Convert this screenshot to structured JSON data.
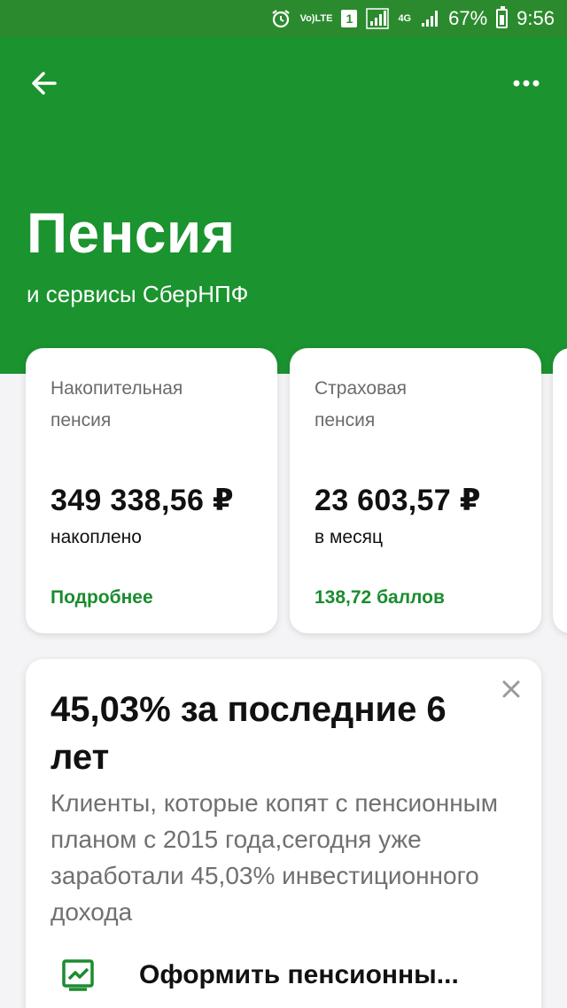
{
  "status_bar": {
    "volte_top": "Vo)",
    "volte_bottom": "LTE",
    "sim_slot": "1",
    "network": "4G",
    "battery": "67%",
    "time": "9:56"
  },
  "header": {
    "title": "Пенсия",
    "subtitle": "и сервисы СберНПФ",
    "background_color": "#1b932f"
  },
  "cards": [
    {
      "label_line1": "Накопительная",
      "label_line2": "пенсия",
      "amount": "349 338,56 ₽",
      "amount_caption": "накоплено",
      "link": "Подробнее"
    },
    {
      "label_line1": "Страховая",
      "label_line2": "пенсия",
      "amount": "23 603,57 ₽",
      "amount_caption": "в месяц",
      "link": "138,72 баллов"
    }
  ],
  "promo": {
    "title": "45,03% за последние 6 лет",
    "text": "Клиенты, которые копят с пенсионным планом с 2015 года,сегодня уже заработали 45,03% инвестиционного дохода",
    "action_label": "Оформить пенсионны..."
  },
  "colors": {
    "accent": "#1b8c2f",
    "status_bar": "#2c8a2e"
  }
}
